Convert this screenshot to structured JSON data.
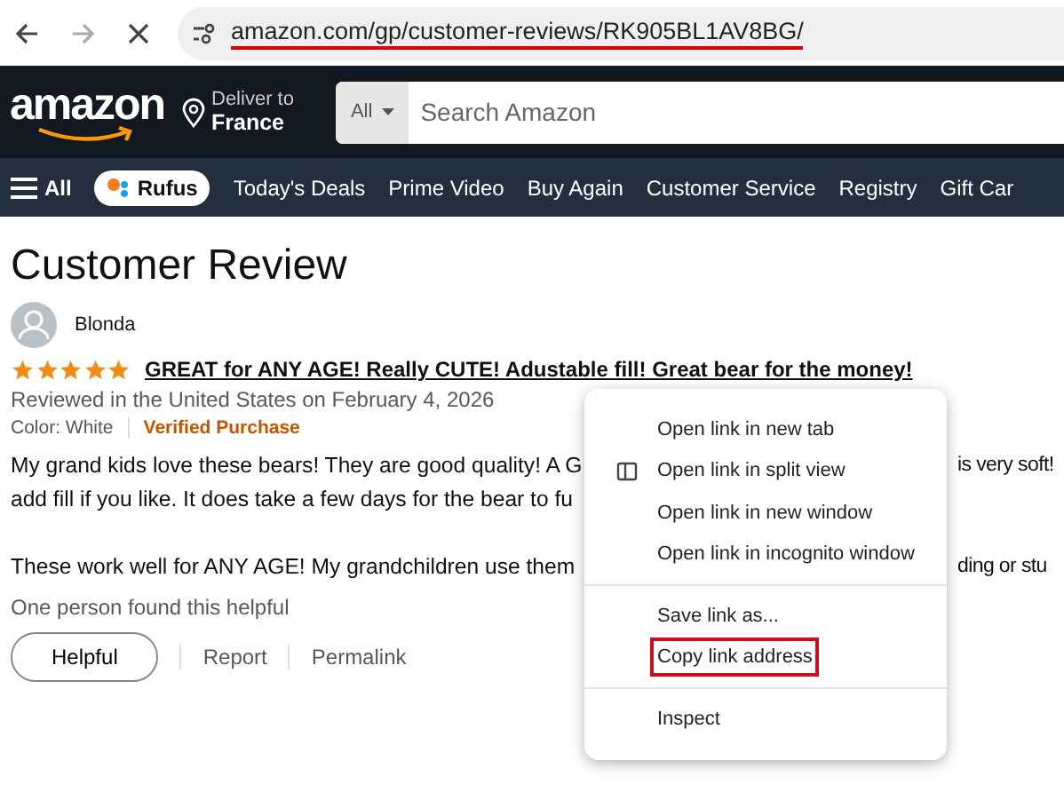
{
  "browser": {
    "url": "amazon.com/gp/customer-reviews/RK905BL1AV8BG/"
  },
  "header": {
    "logo": "amazon",
    "deliver_label": "Deliver to",
    "deliver_country": "France",
    "search_category": "All",
    "search": {
      "placeholder": "Search Amazon"
    }
  },
  "nav": {
    "menu_label": "All",
    "rufus": "Rufus",
    "links": [
      "Today's Deals",
      "Prime Video",
      "Buy Again",
      "Customer Service",
      "Registry",
      "Gift Car"
    ]
  },
  "review": {
    "page_title": "Customer Review",
    "author": "Blonda",
    "stars": 5,
    "title": "GREAT for ANY AGE! Really CUTE! Adustable fill! Great bear for the money!",
    "meta": "Reviewed in the United States on February 4, 2026",
    "variant": "Color: White",
    "verified": "Verified Purchase",
    "body_lines": [
      {
        "kind": "text",
        "left": "My grand kids love these bears! They are good quality! A G",
        "right": "is very soft!"
      },
      {
        "kind": "text",
        "left": "add fill if you like. It does take a few days for the bear to fu"
      },
      {
        "kind": "blank"
      },
      {
        "kind": "text",
        "left": "These work well for ANY AGE! My grandchildren use them",
        "right": "ding or stu"
      }
    ],
    "helpful_count": "One person found this helpful",
    "actions": [
      "Helpful",
      "Report",
      "Permalink"
    ]
  },
  "context_menu": {
    "items": [
      {
        "kind": "item",
        "label": "Open link in new tab",
        "icon": false,
        "highlighted": false
      },
      {
        "kind": "item",
        "label": "Open link in split view",
        "icon": true,
        "highlighted": false
      },
      {
        "kind": "item",
        "label": "Open link in new window",
        "icon": false,
        "highlighted": false
      },
      {
        "kind": "item",
        "label": "Open link in incognito window",
        "icon": false,
        "highlighted": false
      },
      {
        "kind": "divider"
      },
      {
        "kind": "item",
        "label": "Save link as...",
        "icon": false,
        "highlighted": false
      },
      {
        "kind": "item",
        "label": "Copy link address",
        "icon": false,
        "highlighted": true
      },
      {
        "kind": "divider"
      },
      {
        "kind": "item",
        "label": "Inspect",
        "icon": false,
        "highlighted": false
      }
    ]
  }
}
